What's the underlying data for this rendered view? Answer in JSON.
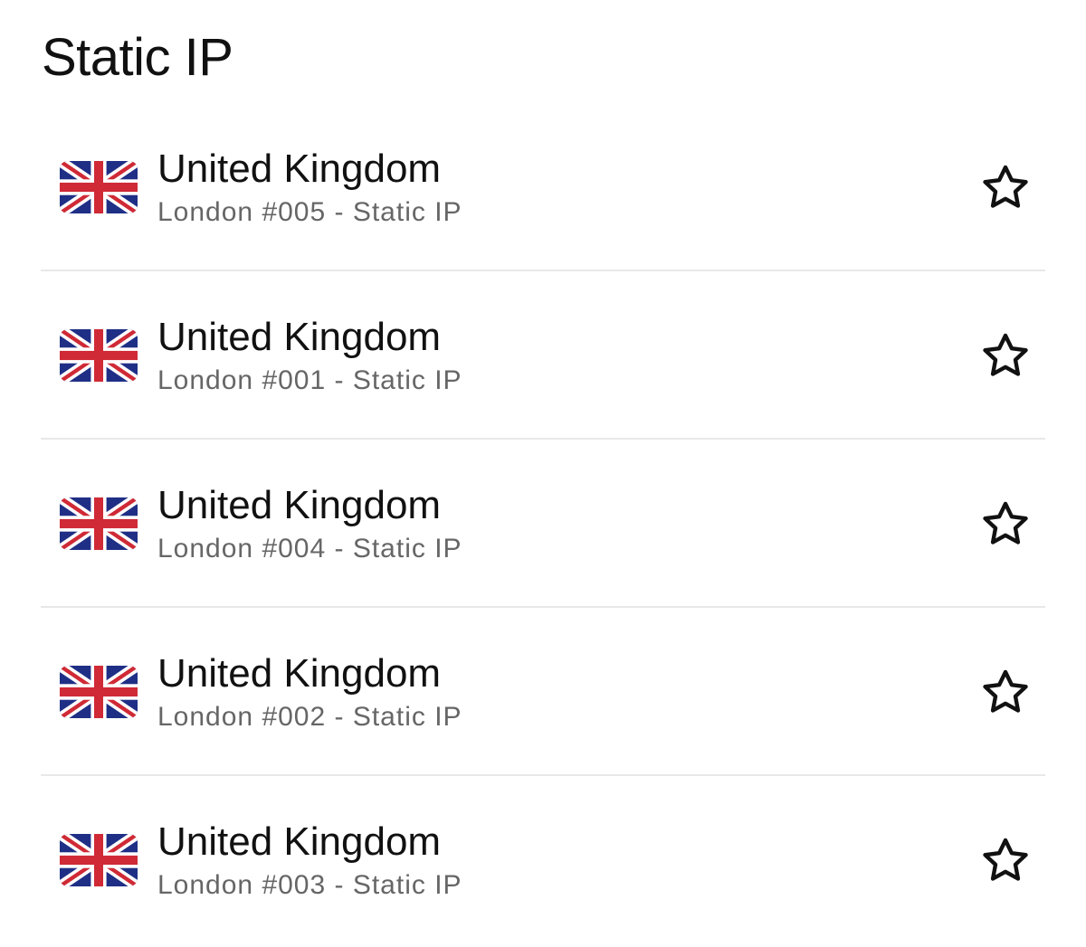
{
  "section": {
    "title": "Static IP"
  },
  "servers": [
    {
      "country": "United Kingdom",
      "detail": "London #005 - Static IP",
      "flag_icon": "uk-flag-icon",
      "favorite_icon": "star-outline-icon"
    },
    {
      "country": "United Kingdom",
      "detail": "London #001 - Static IP",
      "flag_icon": "uk-flag-icon",
      "favorite_icon": "star-outline-icon"
    },
    {
      "country": "United Kingdom",
      "detail": "London #004 - Static IP",
      "flag_icon": "uk-flag-icon",
      "favorite_icon": "star-outline-icon"
    },
    {
      "country": "United Kingdom",
      "detail": "London #002 - Static IP",
      "flag_icon": "uk-flag-icon",
      "favorite_icon": "star-outline-icon"
    },
    {
      "country": "United Kingdom",
      "detail": "London #003 - Static IP",
      "flag_icon": "uk-flag-icon",
      "favorite_icon": "star-outline-icon"
    }
  ],
  "colors": {
    "text_primary": "#111111",
    "text_secondary": "#666666",
    "divider": "#e8e8e8",
    "flag_blue": "#1f2f86",
    "flag_red": "#cf2a36",
    "flag_white": "#ffffff"
  }
}
